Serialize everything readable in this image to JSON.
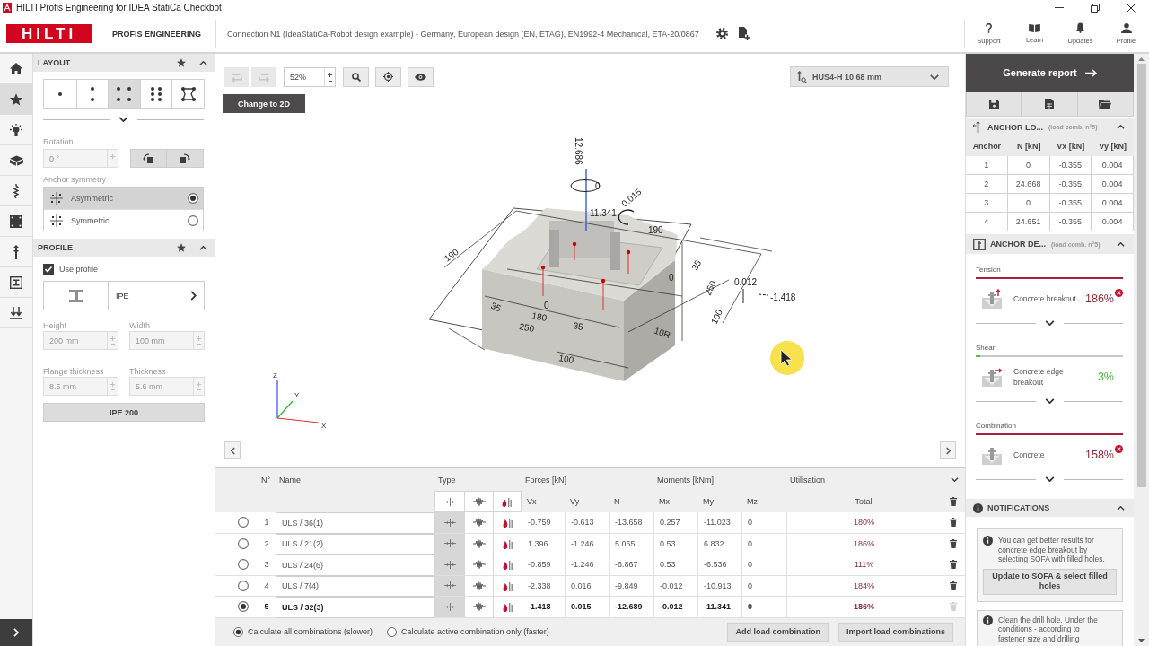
{
  "title_bar": {
    "title": "HILTI Profis Engineering for IDEA StatiCa Checkbot"
  },
  "header": {
    "logo": "HILTI",
    "product": "PROFIS ENGINEERING",
    "project": "Connection N1 (IdeaStatiCa-Robot design example) - Germany, European design (EN, ETAG), EN1992-4 Mechanical, ETA-20/0867",
    "menu": [
      {
        "kind": "support",
        "label": "Support"
      },
      {
        "kind": "learn",
        "label": "Learn"
      },
      {
        "kind": "updates",
        "label": "Updates"
      },
      {
        "kind": "profile",
        "label": "Profile"
      }
    ]
  },
  "rail": [
    {
      "kind": "home",
      "selected": false
    },
    {
      "kind": "star",
      "selected": true
    },
    {
      "kind": "bulb",
      "selected": false
    },
    {
      "kind": "cube",
      "selected": false
    },
    {
      "kind": "drill",
      "selected": false
    },
    {
      "kind": "plate",
      "selected": false
    },
    {
      "kind": "anchor",
      "selected": false
    },
    {
      "kind": "profile",
      "selected": false
    },
    {
      "kind": "loads",
      "selected": false
    }
  ],
  "layout": {
    "title": "LAYOUT",
    "patterns": [
      {
        "kind": "one",
        "selected": false
      },
      {
        "kind": "two",
        "selected": false
      },
      {
        "kind": "four",
        "selected": true
      },
      {
        "kind": "six",
        "selected": false
      },
      {
        "kind": "custom",
        "selected": false
      }
    ],
    "rotation": {
      "label": "Rotation",
      "value": "0 °",
      "disabled": true
    },
    "symmetry": {
      "label": "Anchor symmetry",
      "options": [
        {
          "kind": "asymmetric",
          "label": "Asymmetric",
          "selected": true
        },
        {
          "kind": "symmetric",
          "label": "Symmetric",
          "selected": false
        }
      ]
    }
  },
  "profile": {
    "title": "PROFILE",
    "use_profile": {
      "label": "Use profile",
      "checked": true
    },
    "type": "IPE",
    "fields": [
      {
        "label": "Height",
        "value": "200 mm",
        "disabled": true
      },
      {
        "label": "Width",
        "value": "100 mm",
        "disabled": true
      },
      {
        "label": "Flange thickness",
        "value": "8.5 mm",
        "disabled": true
      },
      {
        "label": "Thickness",
        "value": "5.6 mm",
        "disabled": true
      }
    ],
    "size_button": "IPE 200"
  },
  "toolbar": {
    "history": [
      {
        "kind": "undo",
        "disabled": true
      },
      {
        "kind": "redo",
        "disabled": true
      }
    ],
    "zoom": "52%",
    "view_button": "Change to 2D",
    "anchor": "HUS4-H 10 68 mm"
  },
  "viewport": {
    "model_labels": [
      "12.686",
      "0",
      "11.341",
      "0.015",
      "190",
      "190",
      "35",
      "0",
      "180",
      "250",
      "35",
      "100",
      "35",
      "250",
      "100",
      "0",
      "0.012",
      "-1.418",
      "10R"
    ],
    "axis_labels": [
      "Z",
      "Y",
      "X"
    ]
  },
  "load_table": {
    "headers": {
      "number": "N°",
      "name": "Name",
      "type": "Type",
      "forces": "Forces [kN]",
      "moments": "Moments [kNm]",
      "utilisation": "Utilisation"
    },
    "type_columns": [
      {
        "kind": "static"
      },
      {
        "kind": "seismic"
      },
      {
        "kind": "fire"
      }
    ],
    "columns": [
      "Vx",
      "Vy",
      "N",
      "Mx",
      "My",
      "Mz",
      "Total"
    ],
    "rows": [
      {
        "selected": false,
        "number": "1",
        "name": "ULS / 36(1)",
        "types": [
          {
            "kind": "static",
            "selected": true
          },
          {
            "kind": "seismic",
            "selected": false
          },
          {
            "kind": "fire",
            "selected": false
          }
        ],
        "values": [
          "-0.759",
          "-0.613",
          "-13.658",
          "0.257",
          "-11.023",
          "0"
        ],
        "total": "180%",
        "delete_disabled": false
      },
      {
        "selected": false,
        "number": "2",
        "name": "ULS / 21(2)",
        "types": [
          {
            "kind": "static",
            "selected": true
          },
          {
            "kind": "seismic",
            "selected": false
          },
          {
            "kind": "fire",
            "selected": false
          }
        ],
        "values": [
          "1.396",
          "-1.246",
          "5.065",
          "0.53",
          "6.832",
          "0"
        ],
        "total": "186%",
        "delete_disabled": false
      },
      {
        "selected": false,
        "number": "3",
        "name": "ULS / 24(6)",
        "types": [
          {
            "kind": "static",
            "selected": true
          },
          {
            "kind": "seismic",
            "selected": false
          },
          {
            "kind": "fire",
            "selected": false
          }
        ],
        "values": [
          "-0.859",
          "-1.246",
          "-6.867",
          "0.53",
          "-6.536",
          "0"
        ],
        "total": "111%",
        "delete_disabled": false
      },
      {
        "selected": false,
        "number": "4",
        "name": "ULS / 7(4)",
        "types": [
          {
            "kind": "static",
            "selected": true
          },
          {
            "kind": "seismic",
            "selected": false
          },
          {
            "kind": "fire",
            "selected": false
          }
        ],
        "values": [
          "-2.338",
          "0.016",
          "-9.849",
          "-0.012",
          "-10.913",
          "0"
        ],
        "total": "184%",
        "delete_disabled": false
      },
      {
        "selected": true,
        "number": "5",
        "name": "ULS / 32(3)",
        "types": [
          {
            "kind": "static",
            "selected": true
          },
          {
            "kind": "seismic",
            "selected": false
          },
          {
            "kind": "fire",
            "selected": false
          }
        ],
        "values": [
          "-1.418",
          "0.015",
          "-12.689",
          "-0.012",
          "-11.341",
          "0"
        ],
        "total": "186%",
        "delete_disabled": true
      }
    ]
  },
  "calc_modes": [
    {
      "label": "Calculate all combinations (slower)",
      "selected": true
    },
    {
      "label": "Calculate active combination only (faster)",
      "selected": false
    }
  ],
  "table_buttons": [
    "Add load combination",
    "Import load combinations"
  ],
  "report": {
    "button": "Generate report",
    "actions": [
      {
        "kind": "save"
      },
      {
        "kind": "sheet"
      },
      {
        "kind": "folder"
      }
    ]
  },
  "anchor_loads": {
    "title": "ANCHOR LO...",
    "subtitle": "(load comb. n°5)",
    "columns": [
      "Anchor",
      "N [kN]",
      "Vx [kN]",
      "Vy [kN]"
    ],
    "rows": [
      [
        "1",
        "0",
        "-0.355",
        "0.004"
      ],
      [
        "2",
        "24.668",
        "-0.355",
        "0.004"
      ],
      [
        "3",
        "0",
        "-0.355",
        "0.004"
      ],
      [
        "4",
        "24.651",
        "-0.355",
        "0.004"
      ]
    ]
  },
  "anchor_design": {
    "title": "ANCHOR DE...",
    "subtitle": "(load comb. n°5)",
    "sections": [
      {
        "kind": "tension",
        "title": "Tension",
        "level": 1,
        "failed": true,
        "label": "Concrete breakout",
        "value": "186%"
      },
      {
        "kind": "shear",
        "title": "Shear",
        "level": 0.03,
        "failed": false,
        "label": "Concrete edge breakout",
        "value": "3%"
      },
      {
        "kind": "combination",
        "title": "Combination",
        "level": 1,
        "failed": true,
        "label": "Concrete",
        "value": "158%"
      }
    ]
  },
  "notifications": {
    "title": "NOTIFICATIONS",
    "items": [
      {
        "text": "You can get better results for concrete edge breakout by selecting SOFA with filled holes.",
        "button": "Update to SOFA & select filled holes"
      },
      {
        "text": "Clean the drill hole. Under the conditions - according to fastener size and drilling"
      }
    ]
  }
}
